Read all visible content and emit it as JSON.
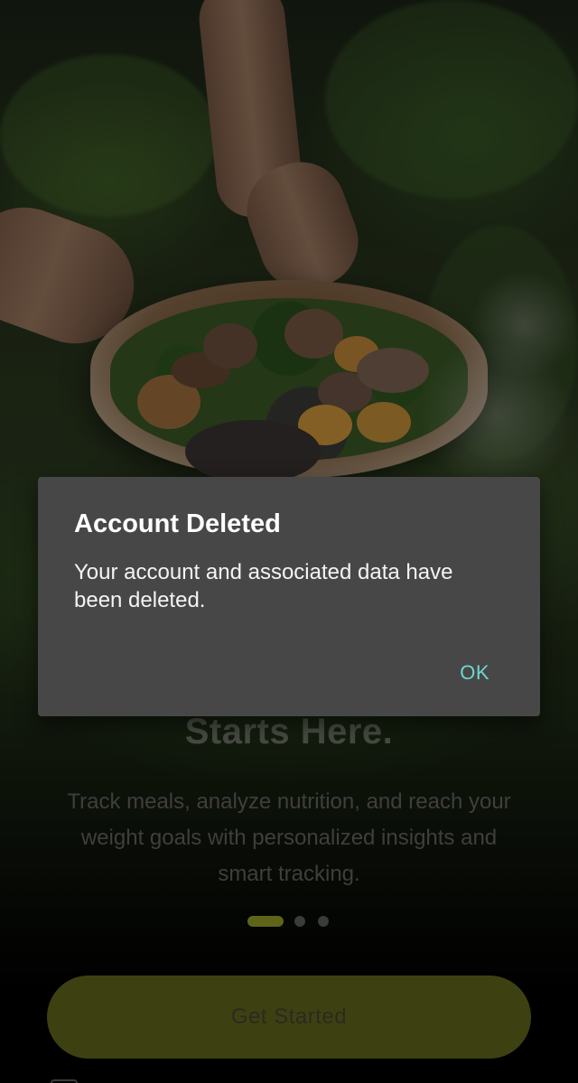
{
  "onboarding": {
    "headline": "Starts Here.",
    "subtitle": "Track meals, analyze nutrition, and reach your weight goals with personalized insights and smart tracking.",
    "pagination": {
      "current": 1,
      "total": 3
    },
    "cta_label": "Get Started"
  },
  "dialog": {
    "title": "Account Deleted",
    "message": "Your account and associated data have been deleted.",
    "ok_label": "OK"
  },
  "colors": {
    "accent": "#5e6519",
    "dialog_bg": "#474747",
    "ok_text": "#6fd6cc"
  }
}
